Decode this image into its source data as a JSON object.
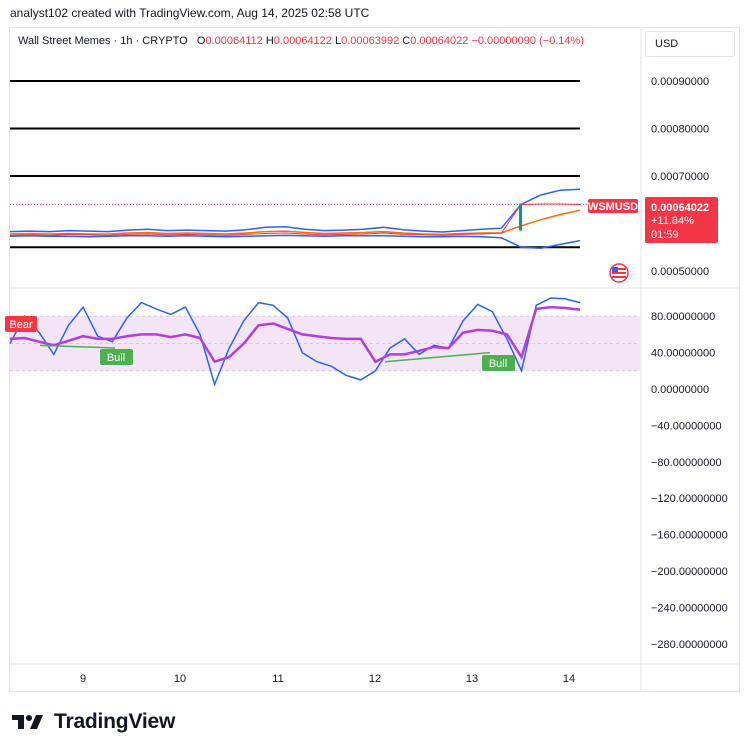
{
  "header": {
    "attribution": "analyst102 created with TradingView.com, Aug 14, 2025 02:58 UTC"
  },
  "legend": {
    "symbol": "Wall Street Memes · 1h · CRYPTO",
    "open_label": "O",
    "open": "0.00064112",
    "high_label": "H",
    "high": "0.00064122",
    "low_label": "L",
    "low": "0.00063992",
    "close_label": "C",
    "close": "0.00064022",
    "change": "−0.00000090 (−0.14%)"
  },
  "currency_button": "USD",
  "price_tag": {
    "symbol": "WSMUSD",
    "price": "0.00064022",
    "change_pct": "+11.84%",
    "countdown": "01:59",
    "color": "#f23645"
  },
  "oscillator_labels": {
    "bear": "Bear",
    "bull_1": "Bull",
    "bull_2": "Bull"
  },
  "brand": {
    "name": "TradingView"
  },
  "colors": {
    "support_resistance": "#000000",
    "bollinger": "#2962ff",
    "moving_average": "#ff6d00",
    "candle_up": "#089981",
    "candle_down": "#f23645",
    "stoch_k": "#2962ff",
    "rsi": "#b33fd6",
    "bull_label": "#4caf50",
    "bear_label": "#f23645",
    "rsi_band": "#f3e5f5"
  },
  "chart_data": [
    {
      "type": "line",
      "panel": "price",
      "y_axis_ticks": [
        "0.00090000",
        "0.00080000",
        "0.00070000",
        "0.00050000"
      ],
      "ylim": [
        0.00046,
        0.00093
      ],
      "x_axis_ticks": [
        "9",
        "10",
        "11",
        "12",
        "13",
        "14"
      ],
      "horizontal_levels": [
        0.0009,
        0.0008,
        0.0007,
        0.00055
      ],
      "series": [
        {
          "values": [
            0.000575,
            0.000576,
            0.000575,
            0.000577,
            0.000576,
            0.000575,
            0.000577,
            0.000578,
            0.000576,
            0.000577,
            0.000576,
            0.000575,
            0.000577,
            0.000579,
            0.00058,
            0.000578,
            0.000576,
            0.000577,
            0.000578,
            0.00058,
            0.000577,
            0.000576,
            0.000575,
            0.000577,
            0.000578,
            0.00058,
            0.00064,
            0.000641,
            0.000641,
            0.00064
          ]
        },
        {
          "values": [
            0.000578,
            0.000579,
            0.000578,
            0.000579,
            0.000578,
            0.000578,
            0.00058,
            0.000581,
            0.000579,
            0.00058,
            0.000579,
            0.000578,
            0.00058,
            0.000583,
            0.000584,
            0.000581,
            0.000579,
            0.00058,
            0.000581,
            0.000583,
            0.00058,
            0.000578,
            0.000577,
            0.000579,
            0.00058,
            0.00058,
            0.000595,
            0.000608,
            0.000619,
            0.000628
          ]
        },
        {
          "values": [
            0.000583,
            0.000584,
            0.000583,
            0.000585,
            0.000584,
            0.000583,
            0.000586,
            0.000588,
            0.000585,
            0.000586,
            0.000585,
            0.000584,
            0.000587,
            0.000592,
            0.000593,
            0.000588,
            0.000585,
            0.000586,
            0.000588,
            0.000592,
            0.000587,
            0.000584,
            0.000582,
            0.000585,
            0.000588,
            0.00059,
            0.00064,
            0.00066,
            0.00067,
            0.000672
          ]
        },
        {
          "values": [
            0.000573,
            0.000574,
            0.000573,
            0.000573,
            0.000572,
            0.000573,
            0.000574,
            0.000574,
            0.000573,
            0.000574,
            0.000573,
            0.000572,
            0.000573,
            0.000574,
            0.000575,
            0.000574,
            0.000573,
            0.000574,
            0.000574,
            0.000574,
            0.000573,
            0.000572,
            0.000572,
            0.000573,
            0.000572,
            0.00057,
            0.00055,
            0.000548,
            0.000556,
            0.000564
          ]
        }
      ]
    },
    {
      "type": "line",
      "panel": "oscillator",
      "y_axis_ticks": [
        "80.00000000",
        "40.00000000",
        "0.00000000",
        "−40.00000000",
        "−80.00000000",
        "−120.00000000",
        "−160.00000000",
        "−200.00000000",
        "−240.00000000",
        "−280.00000000"
      ],
      "ylim": [
        -300,
        110
      ],
      "x_axis_ticks": [
        "9",
        "10",
        "11",
        "12",
        "13",
        "14"
      ],
      "band": [
        20,
        80
      ],
      "series": [
        {
          "values": [
            50,
            80,
            62,
            38,
            70,
            90,
            58,
            52,
            78,
            95,
            88,
            82,
            90,
            60,
            5,
            45,
            75,
            95,
            92,
            78,
            40,
            30,
            25,
            15,
            10,
            20,
            45,
            55,
            38,
            48,
            45,
            75,
            93,
            85,
            55,
            20,
            92,
            100,
            99,
            95
          ]
        },
        {
          "values": [
            55,
            56,
            52,
            48,
            53,
            58,
            55,
            55,
            58,
            60,
            60,
            57,
            60,
            56,
            30,
            35,
            50,
            70,
            72,
            66,
            60,
            58,
            56,
            55,
            55,
            30,
            38,
            38,
            42,
            46,
            45,
            62,
            65,
            64,
            60,
            35,
            88,
            90,
            89,
            87
          ]
        }
      ]
    }
  ]
}
